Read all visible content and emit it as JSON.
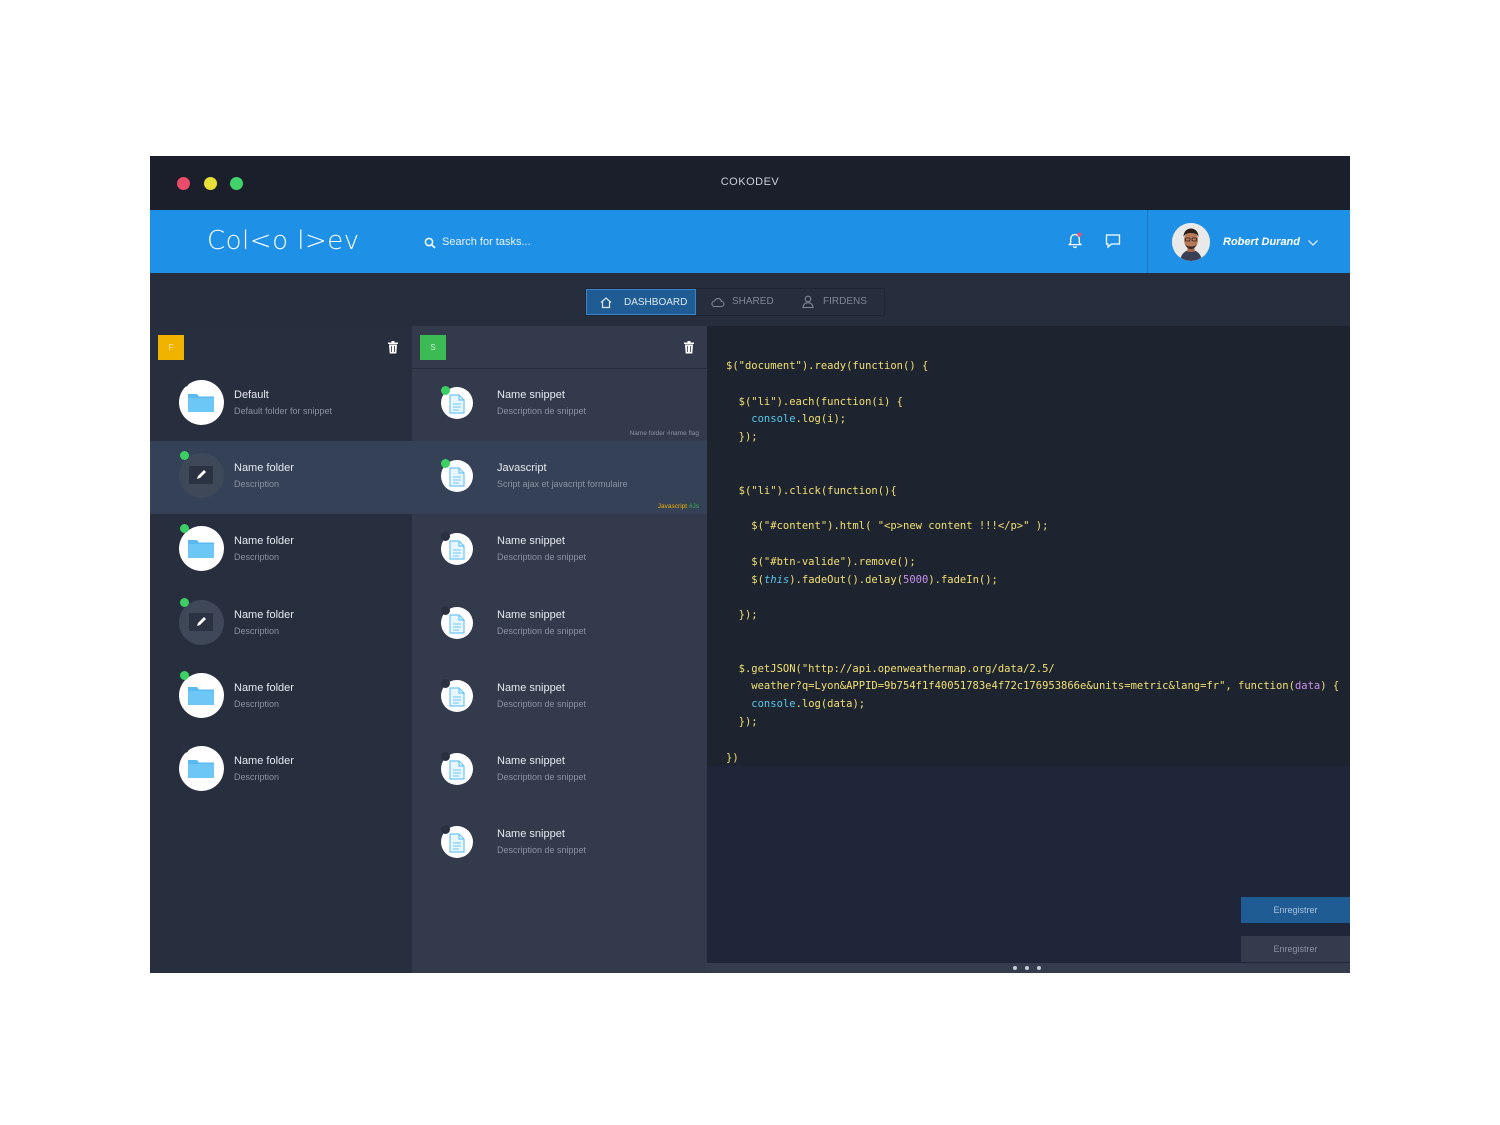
{
  "window": {
    "title": "COKODEV"
  },
  "header": {
    "logo": "Col<o l>ev",
    "search_placeholder": "Search for tasks...",
    "user_name": "Robert Durand"
  },
  "tabs": [
    {
      "label": "DASHBOARD",
      "icon": "home-icon"
    },
    {
      "label": "SHARED",
      "icon": "cloud-icon"
    },
    {
      "label": "FIRDENS",
      "icon": "user-icon"
    }
  ],
  "folders": {
    "badge": "F",
    "items": [
      {
        "title": "Default",
        "desc": "Default folder for snippet",
        "icon": "folder-icon",
        "status": "off"
      },
      {
        "title": "Name folder",
        "desc": "Description",
        "icon": "edit-icon",
        "status": "on"
      },
      {
        "title": "Name folder",
        "desc": "Description",
        "icon": "folder-icon",
        "status": "on"
      },
      {
        "title": "Name folder",
        "desc": "Description",
        "icon": "edit-icon",
        "status": "on"
      },
      {
        "title": "Name folder",
        "desc": "Description",
        "icon": "folder-icon",
        "status": "on"
      },
      {
        "title": "Name folder",
        "desc": "Description",
        "icon": "folder-icon",
        "status": "off"
      }
    ]
  },
  "snippets": {
    "badge": "S",
    "items": [
      {
        "title": "Name snippet",
        "desc": "Description de snippet",
        "status": "on",
        "tag_a": "Name folder",
        "tag_b": "#name flag"
      },
      {
        "title": "Javascript",
        "desc": "Script ajax et javacript formulaire",
        "status": "on",
        "tag_a": "Javascript",
        "tag_b": "#Js"
      },
      {
        "title": "Name snippet",
        "desc": "Description de snippet",
        "status": "off"
      },
      {
        "title": "Name snippet",
        "desc": "Description de snippet",
        "status": "off"
      },
      {
        "title": "Name snippet",
        "desc": "Description de snippet",
        "status": "off"
      },
      {
        "title": "Name snippet",
        "desc": "Description de snippet",
        "status": "off"
      },
      {
        "title": "Name snippet",
        "desc": "Description de snippet",
        "status": "off"
      }
    ]
  },
  "code": [
    [
      [
        "$(\"document\").ready(function() {",
        "y"
      ]
    ],
    [],
    [
      [
        "  $(\"li\").each(function(i) {",
        "y"
      ]
    ],
    [
      [
        "    console",
        "c"
      ],
      [
        ".log(i);",
        "y"
      ]
    ],
    [
      [
        "  });",
        "y"
      ]
    ],
    [],
    [],
    [
      [
        "  $(\"li\").click(function(){",
        "y"
      ]
    ],
    [],
    [
      [
        "    $(\"#content\").html( \"<p>new content !!!</p>\" );",
        "y"
      ]
    ],
    [],
    [
      [
        "    $(\"#btn-valide\").remove();",
        "y"
      ]
    ],
    [
      [
        "    $(",
        "y"
      ],
      [
        "this",
        "c"
      ],
      [
        ").fadeOut().delay(",
        "y"
      ],
      [
        "5000",
        "p"
      ],
      [
        ").fadeIn();",
        "y"
      ]
    ],
    [],
    [
      [
        "  });",
        "y"
      ]
    ],
    [],
    [],
    [
      [
        "  $.getJSON(\"http://api.openweathermap.org/data/2.5/",
        "y"
      ]
    ],
    [
      [
        "    weather?q=Lyon&APPID=9b754f1f40051783e4f72c176953866e&units=metric&lang=fr\", function(",
        "y"
      ],
      [
        "data",
        "p"
      ],
      [
        ") {",
        "y"
      ]
    ],
    [
      [
        "    console",
        "c"
      ],
      [
        ".log(data);",
        "y"
      ]
    ],
    [
      [
        "  });",
        "y"
      ]
    ],
    [],
    [
      [
        "})",
        "y"
      ]
    ]
  ],
  "buttons": {
    "save_primary": "Enregistrer",
    "save_secondary": "Enregistrer"
  },
  "colors": {
    "accent": "#1e90e6",
    "folder_badge": "#f0b400",
    "snippet_badge": "#3cba54",
    "status_on": "#3cd064",
    "status_off": "#2a3040",
    "folder_icon": "#5ab9f0",
    "tag_a": "#f0b400",
    "tag_b": "#3cba54"
  }
}
